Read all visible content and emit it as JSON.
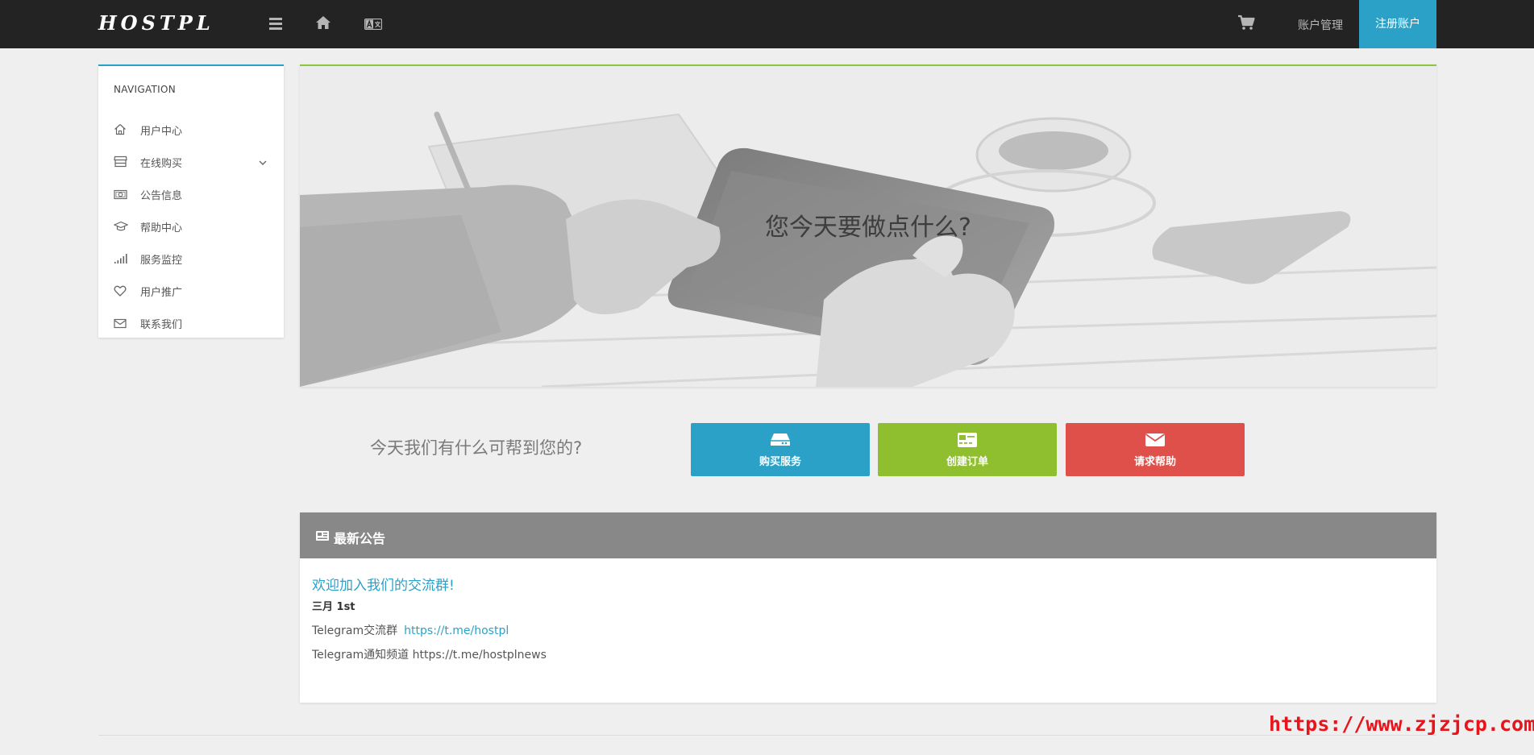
{
  "header": {
    "logo": "HOSTPL",
    "account_link": "账户管理",
    "register_button": "注册账户"
  },
  "sidebar": {
    "title": "NAVIGATION",
    "items": [
      {
        "label": "用户中心",
        "icon": "home-icon"
      },
      {
        "label": "在线购买",
        "icon": "store-icon",
        "has_submenu": true
      },
      {
        "label": "公告信息",
        "icon": "money-icon"
      },
      {
        "label": "帮助中心",
        "icon": "graduation-cap-icon"
      },
      {
        "label": "服务监控",
        "icon": "signal-icon"
      },
      {
        "label": "用户推广",
        "icon": "heart-icon"
      },
      {
        "label": "联系我们",
        "icon": "envelope-icon"
      }
    ]
  },
  "hero": {
    "title": "您今天要做点什么?"
  },
  "quick_actions": {
    "prompt": "今天我们有什么可帮到您的?",
    "buttons": [
      {
        "label": "购买服务",
        "icon": "server-icon",
        "color": "#2ba1c8"
      },
      {
        "label": "创建订单",
        "icon": "credit-card-icon",
        "color": "#8fbf2f"
      },
      {
        "label": "请求帮助",
        "icon": "envelope-icon",
        "color": "#de5049"
      }
    ]
  },
  "announcements": {
    "heading": "最新公告",
    "title": "欢迎加入我们的交流群!",
    "date": "三月 1st",
    "line1_text": "Telegram交流群",
    "line1_link": "https://t.me/hostpl",
    "line2_text": "Telegram通知频道 https://t.me/hostplnews"
  },
  "watermark": "https://www.zjzjcp.com",
  "colors": {
    "topbar": "#232323",
    "accent_blue": "#2ba1c8",
    "accent_green": "#8fbf2f",
    "accent_red": "#de5049",
    "announcement_header": "#888888"
  }
}
